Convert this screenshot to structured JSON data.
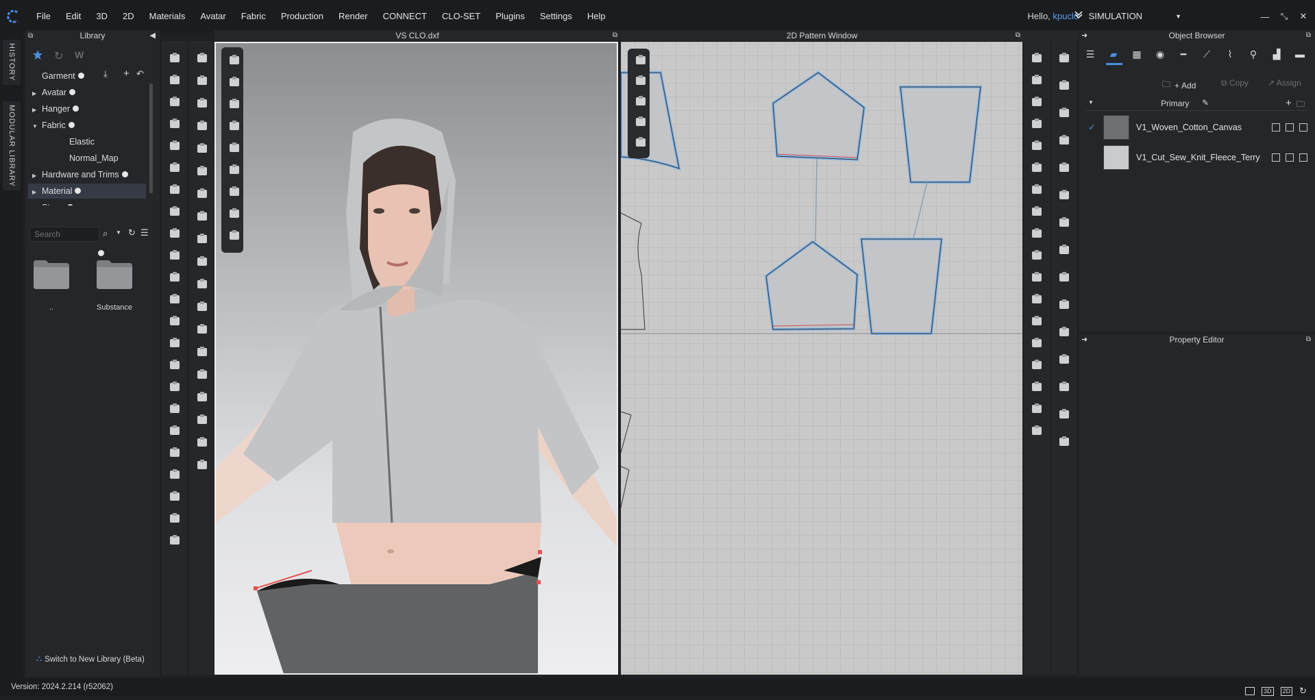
{
  "menubar": {
    "items": [
      "File",
      "Edit",
      "3D",
      "2D",
      "Materials",
      "Avatar",
      "Fabric",
      "Production",
      "Render",
      "CONNECT",
      "CLO-SET",
      "Plugins",
      "Settings",
      "Help"
    ],
    "greeting": "Hello,",
    "username": "kpuclo",
    "mode": "SIMULATION"
  },
  "side_tabs": {
    "history": "HISTORY",
    "modular": "MODULAR LIBRARY"
  },
  "library": {
    "title": "Library",
    "tree": [
      {
        "label": "Garment",
        "caret": false,
        "indent": 0
      },
      {
        "label": "Avatar",
        "caret": "right",
        "indent": 0
      },
      {
        "label": "Hanger",
        "caret": "right",
        "indent": 0
      },
      {
        "label": "Fabric",
        "caret": "down",
        "indent": 0
      },
      {
        "label": "Elastic",
        "caret": false,
        "indent": 1
      },
      {
        "label": "Normal_Map",
        "caret": false,
        "indent": 1
      },
      {
        "label": "Hardware and Trims",
        "caret": "right",
        "indent": 0
      },
      {
        "label": "Material",
        "caret": "right",
        "indent": 0,
        "selected": true
      },
      {
        "label": "Stage",
        "caret": "right",
        "indent": 0
      }
    ],
    "search_placeholder": "Search",
    "folders": [
      "..",
      "Substance"
    ],
    "switch_label": "Switch to New Library (Beta)"
  },
  "viewport3d": {
    "title": "VS CLO.dxf"
  },
  "viewport2d": {
    "title": "2D Pattern Window"
  },
  "object_browser": {
    "title": "Object Browser",
    "add_label": "Add",
    "copy_label": "Copy",
    "assign_label": "Assign",
    "group_label": "Primary",
    "fabrics": [
      {
        "name": "V1_Woven_Cotton_Canvas",
        "color": "#6e7073",
        "checked": true
      },
      {
        "name": "V1_Cut_Sew_Knit_Fleece_Terry",
        "color": "#c9cbce",
        "checked": false
      }
    ]
  },
  "property_editor": {
    "title": "Property Editor"
  },
  "status": {
    "version": "Version: 2024.2.214 (r52062)",
    "view_buttons": [
      "3D",
      "2D"
    ]
  },
  "colors": {
    "accent": "#4a90e2",
    "background": "#1f2023",
    "panel": "#252629"
  }
}
